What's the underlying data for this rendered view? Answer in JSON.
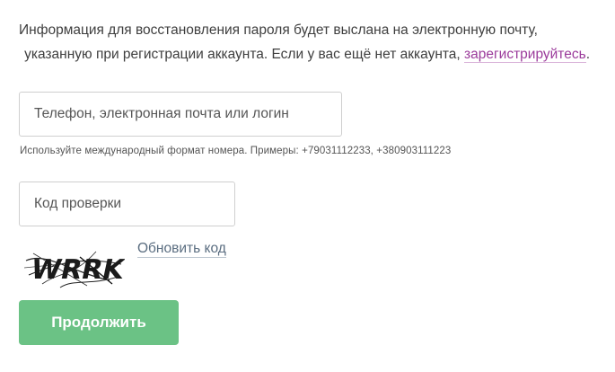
{
  "info": {
    "line1": "Информация для восстановления пароля будет выслана на электронную почту,",
    "line2_prefix": "указанную при регистрации аккаунта. Если у вас ещё нет аккаунта, ",
    "register_link": "зарегистрируйтесь",
    "line2_suffix": "."
  },
  "login_field": {
    "placeholder": "Телефон, электронная почта или логин",
    "value": ""
  },
  "phone_hint": "Используйте международный формат номера. Примеры: +79031112233, +380903111223",
  "captcha_field": {
    "placeholder": "Код проверки",
    "value": ""
  },
  "captcha": {
    "icon": "captcha-image",
    "text": "WRRK"
  },
  "refresh_link": "Обновить код",
  "submit_button": "Продолжить",
  "colors": {
    "link": "#9b3b9b",
    "refresh_link": "#5a6d80",
    "button": "#6bc285"
  }
}
